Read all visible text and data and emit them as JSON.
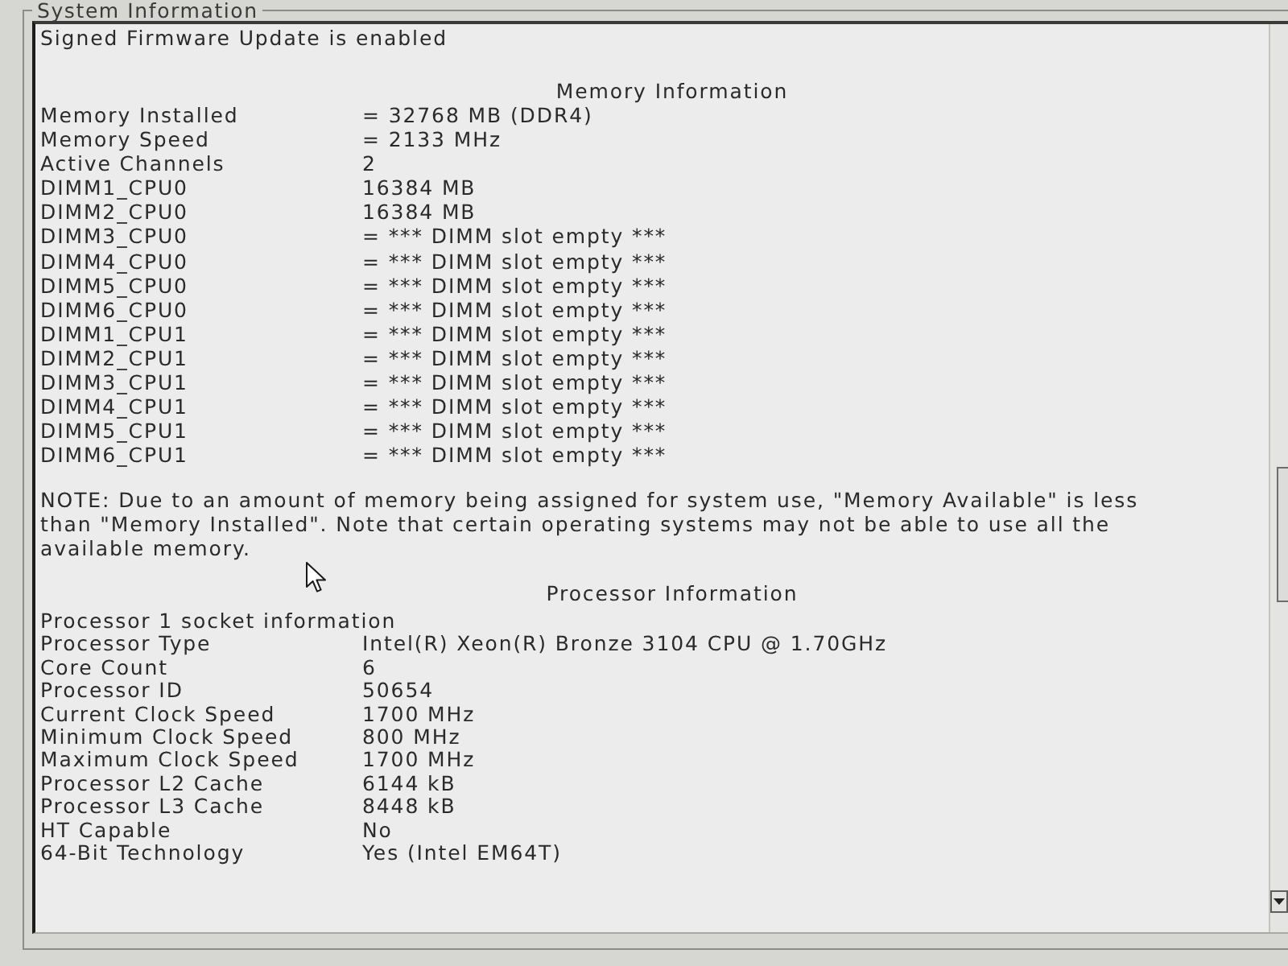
{
  "window": {
    "title": "System Information"
  },
  "status": "Signed Firmware Update is enabled",
  "memory": {
    "heading": "Memory Information",
    "rows": [
      {
        "label": "Memory Installed",
        "value": "= 32768 MB (DDR4)"
      },
      {
        "label": "Memory Speed",
        "value": "= 2133 MHz"
      },
      {
        "label": "Active Channels",
        "value": "2"
      },
      {
        "label": "DIMM1_CPU0",
        "value": "16384 MB"
      },
      {
        "label": "DIMM2_CPU0",
        "value": "16384 MB"
      },
      {
        "label": "DIMM3_CPU0",
        "value": "= *** DIMM slot empty ***"
      },
      {
        "label": "DIMM4_CPU0",
        "value": "= *** DIMM slot empty ***"
      },
      {
        "label": "DIMM5_CPU0",
        "value": "= *** DIMM slot empty ***"
      },
      {
        "label": "DIMM6_CPU0",
        "value": "= *** DIMM slot empty ***"
      },
      {
        "label": "DIMM1_CPU1",
        "value": "= *** DIMM slot empty ***"
      },
      {
        "label": "DIMM2_CPU1",
        "value": "= *** DIMM slot empty ***"
      },
      {
        "label": "DIMM3_CPU1",
        "value": "= *** DIMM slot empty ***"
      },
      {
        "label": "DIMM4_CPU1",
        "value": "= *** DIMM slot empty ***"
      },
      {
        "label": "DIMM5_CPU1",
        "value": "= *** DIMM slot empty ***"
      },
      {
        "label": "DIMM6_CPU1",
        "value": "= *** DIMM slot empty ***"
      }
    ]
  },
  "note": "NOTE: Due to an amount of memory being assigned for system use, \"Memory Available\" is less than \"Memory Installed\". Note that certain operating systems may not be able to use all the available memory.",
  "processor": {
    "heading": "Processor Information",
    "subheading": "Processor 1 socket information",
    "rows": [
      {
        "label": "Processor Type",
        "value": "Intel(R) Xeon(R) Bronze 3104 CPU @ 1.70GHz"
      },
      {
        "label": "Core Count",
        "value": "6"
      },
      {
        "label": "Processor ID",
        "value": "50654"
      },
      {
        "label": "Current Clock Speed",
        "value": "1700 MHz"
      },
      {
        "label": "Minimum Clock Speed",
        "value": "800 MHz"
      },
      {
        "label": "Maximum Clock Speed",
        "value": "1700 MHz"
      },
      {
        "label": "Processor L2 Cache",
        "value": "6144 kB"
      },
      {
        "label": "Processor L3 Cache",
        "value": "8448 kB"
      },
      {
        "label": "HT Capable",
        "value": "No"
      },
      {
        "label": "64-Bit Technology",
        "value": "Yes (Intel EM64T)"
      }
    ]
  }
}
